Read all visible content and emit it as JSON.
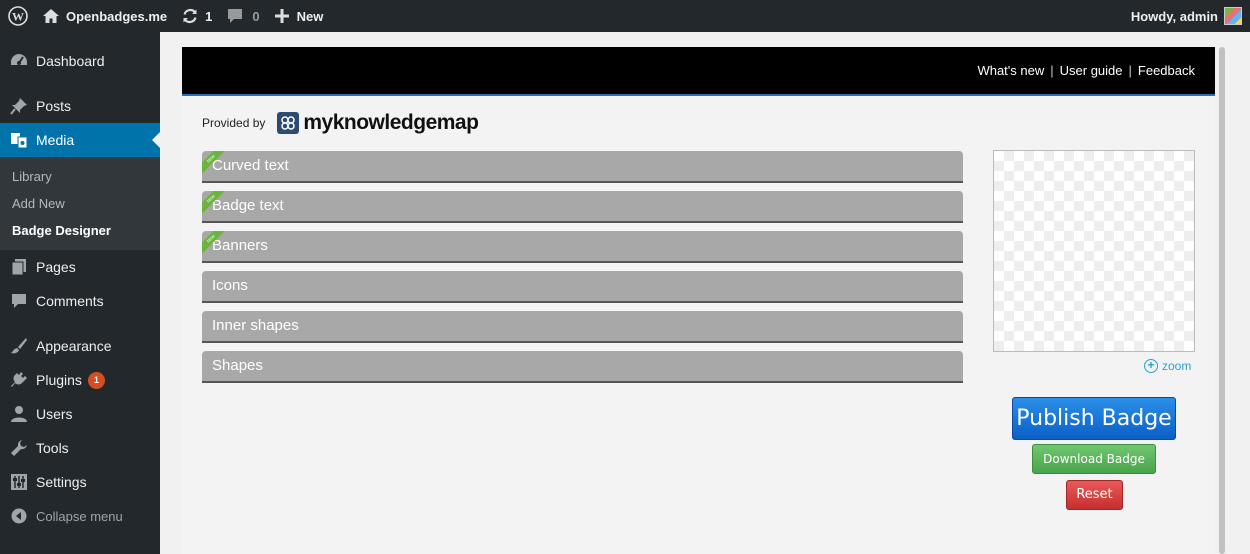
{
  "adminbar": {
    "site_name": "Openbadges.me",
    "updates_count": "1",
    "comments_count": "0",
    "new_label": "New",
    "howdy": "Howdy, admin"
  },
  "sidebar": {
    "items": [
      {
        "label": "Dashboard",
        "icon": "dashboard-icon"
      },
      {
        "label": "Posts",
        "icon": "pin-icon"
      },
      {
        "label": "Media",
        "icon": "media-icon"
      },
      {
        "label": "Pages",
        "icon": "page-icon"
      },
      {
        "label": "Comments",
        "icon": "comment-icon"
      },
      {
        "label": "Appearance",
        "icon": "brush-icon"
      },
      {
        "label": "Plugins",
        "icon": "plugin-icon",
        "badge": "1"
      },
      {
        "label": "Users",
        "icon": "user-icon"
      },
      {
        "label": "Tools",
        "icon": "wrench-icon"
      },
      {
        "label": "Settings",
        "icon": "settings-icon"
      }
    ],
    "submenu": [
      "Library",
      "Add New",
      "Badge Designer"
    ],
    "collapse": "Collapse menu"
  },
  "designer": {
    "links": [
      "What's new",
      "User guide",
      "Feedback"
    ],
    "provided_by": "Provided by",
    "logo_text": "myknowledgemap",
    "sections": [
      "Curved text",
      "Badge text",
      "Banners",
      "Icons",
      "Inner shapes",
      "Shapes"
    ],
    "ribbon": "NEW",
    "zoom": "zoom",
    "publish": "Publish Badge",
    "download": "Download Badge",
    "reset": "Reset"
  },
  "colors": {
    "accent": "#0073aa",
    "adminbar": "#23282d",
    "publish": "#1a73d6",
    "download": "#5cb85c",
    "reset": "#d64040"
  }
}
